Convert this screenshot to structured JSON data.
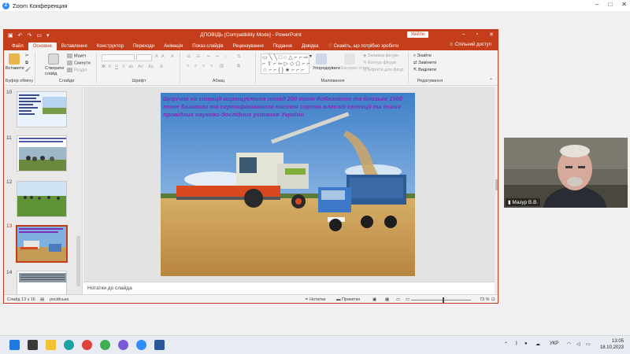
{
  "zoom": {
    "title": "Zoom Конференция",
    "logo_letter": "Z",
    "controls": {
      "minimize": "–",
      "maximize": "□",
      "close": "✕"
    }
  },
  "ppt": {
    "doc_title": "ДПОВІДЬ [Compatibility Mode] - PowerPoint",
    "signin": "Увійти",
    "window": {
      "minimize": "–",
      "restore": "▫",
      "close": "✕"
    },
    "tabs": [
      "Файл",
      "Основне",
      "Вставлення",
      "Конструктор",
      "Переходи",
      "Анімація",
      "Показ слайдів",
      "Рецензування",
      "Подання",
      "Довідка"
    ],
    "active_tab": "Основне",
    "tell_me": "Скажіть, що потрібно зробити",
    "share": "Спільний доступ",
    "ribbon": {
      "clipboard": {
        "paste": "Вставити",
        "label": "Буфер обміну"
      },
      "slides": {
        "new_slide": "Створити слайд",
        "layout": "Макет",
        "reset": "Скинути",
        "section": "Розділ",
        "label": "Слайди"
      },
      "font": {
        "label": "Шрифт"
      },
      "paragraph": {
        "label": "Абзац"
      },
      "drawing": {
        "arrange": "Упорядкувати",
        "quick_styles": "Експрес-стилі",
        "fill": "Заливка фігури",
        "outline": "Контур фігури",
        "effects": "Ефекти для фігур",
        "label": "Малювання"
      },
      "editing": {
        "find": "Знайти",
        "replace": "Замінити",
        "select": "Виділити",
        "label": "Редагування"
      }
    },
    "thumbnails": [
      {
        "num": "10",
        "selected": false
      },
      {
        "num": "11",
        "selected": false
      },
      {
        "num": "12",
        "selected": false
      },
      {
        "num": "13",
        "selected": true
      },
      {
        "num": "14",
        "selected": false
      }
    ],
    "slide_text": "Щорічно на станції вирощується понад  200 тонн добазового та близько 1500  тонн базового та сертифікованого насіння сортів власної селекції та інших провідних науково-дослідних установ України",
    "notes_placeholder": "Нотатки до слайда",
    "status": {
      "slide_count": "Слайд 13 з 16",
      "language": "російська",
      "notes_btn": "Нотатки",
      "comments_btn": "Примітки",
      "zoom": "73 %",
      "zoom_level": 0.73
    }
  },
  "video": {
    "name": "Мазур В.В."
  },
  "taskbar": {
    "tray": {
      "lang": "УКР",
      "time": "13:05",
      "date": "18.10.2023"
    }
  }
}
